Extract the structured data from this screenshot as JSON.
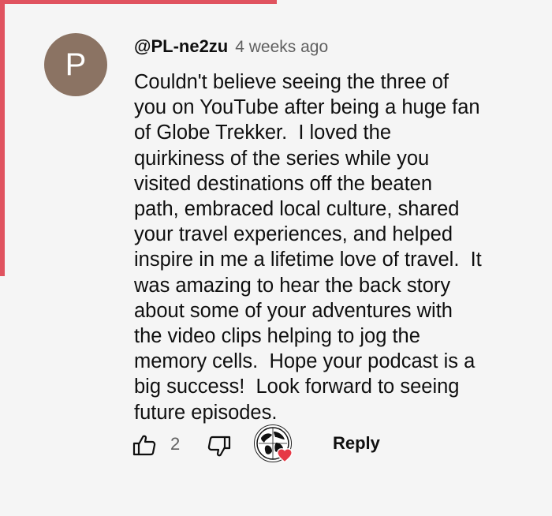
{
  "comment": {
    "avatar_letter": "P",
    "author": "@PL-ne2zu",
    "timestamp": "4 weeks ago",
    "text": "Couldn't believe seeing the three of\nyou on YouTube after being a huge fan\nof Globe Trekker.  I loved the\nquirkiness of the series while you\nvisited destinations off the beaten\npath, embraced local culture, shared\nyour travel experiences, and helped\ninspire in me a lifetime love of travel.  It\nwas amazing to hear the back story\nabout some of your adventures with\nthe video clips helping to jog the\nmemory cells.  Hope your podcast is a\nbig success!  Look forward to seeing\nfuture episodes."
  },
  "actions": {
    "like_icon": "thumbs-up-icon",
    "like_count": "2",
    "dislike_icon": "thumbs-down-icon",
    "creator_heart_icon": "heart-icon",
    "reply_label": "Reply"
  },
  "colors": {
    "accent": "#e0535f",
    "avatar_bg": "#8b7363",
    "heart": "#e63946",
    "background": "#f5f5f5"
  }
}
